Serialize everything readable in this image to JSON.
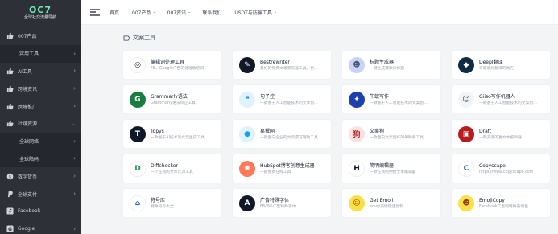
{
  "logo": {
    "mark": "OC7",
    "subtitle": "全球社交流量导航"
  },
  "sidebar": {
    "items": [
      {
        "label": "007产品",
        "icon": "thumb-up-icon",
        "arrow": ""
      },
      {
        "label": "实用工具",
        "icon": "",
        "arrow": "›",
        "sub": true
      },
      {
        "label": "AI工具",
        "icon": "thumb-up-icon",
        "arrow": "›"
      },
      {
        "label": "跨境资讯",
        "icon": "thumb-up-icon",
        "arrow": "›"
      },
      {
        "label": "跨境推广",
        "icon": "thumb-up-icon",
        "arrow": "›"
      },
      {
        "label": "社媒资源",
        "icon": "thumb-up-icon",
        "arrow": "⌄"
      },
      {
        "label": "全球网络",
        "icon": "",
        "arrow": "›",
        "sub": true
      },
      {
        "label": "全球陆码",
        "icon": "",
        "arrow": "›",
        "sub": true
      },
      {
        "label": "数字货币",
        "icon": "dollar-icon",
        "arrow": "›"
      },
      {
        "label": "全球支付",
        "icon": "paypal-icon",
        "arrow": "›"
      },
      {
        "label": "Facebook",
        "icon": "facebook-icon",
        "arrow": ""
      },
      {
        "label": "Google",
        "icon": "google-icon",
        "arrow": "›"
      }
    ]
  },
  "topbar": {
    "links": [
      {
        "label": "首页",
        "caret": ""
      },
      {
        "label": "007产品",
        "caret": "⌄"
      },
      {
        "label": "007资讯",
        "caret": "⌄"
      },
      {
        "label": "联系我们",
        "caret": ""
      },
      {
        "label": "USDT与防骗工具",
        "caret": "⌄"
      }
    ]
  },
  "section": {
    "title": "文案工具"
  },
  "cards": [
    {
      "title": "编辑词处理工具",
      "desc": "FB、Google广告的处理敏感词",
      "icon": "target-icon",
      "color": "#ffffff",
      "fg": "#111827",
      "glyph": "◎"
    },
    {
      "title": "Bestrewriter",
      "desc": "最好的免费文章重写器工具。仿…",
      "icon": "pen-icon",
      "color": "#111827",
      "fg": "#ffffff",
      "glyph": "✎"
    },
    {
      "title": "标题生成器",
      "desc": "一键生成爆款诗标题",
      "icon": "owl-icon",
      "color": "#c7d2fe",
      "fg": "#4b5563",
      "glyph": "☻"
    },
    {
      "title": "Deepl翻译",
      "desc": "可靠最好翻译的地方",
      "icon": "deepl-icon",
      "color": "#0f2b46",
      "fg": "#ffffff",
      "glyph": "◆"
    },
    {
      "title": "Grammarly语法",
      "desc": "Grammarly语法纠正工具",
      "icon": "grammarly-icon",
      "color": "#15803d",
      "fg": "#ffffff",
      "glyph": "G"
    },
    {
      "title": "句子控",
      "desc": "一款基于人工智能技术的文本创…",
      "icon": "quote-icon",
      "color": "#e0f2fe",
      "fg": "#0284c7",
      "glyph": "❝"
    },
    {
      "title": "牛蚁写作",
      "desc": "一款基于人工智能技术的文案创…",
      "icon": "ant-icon",
      "color": "#1e40af",
      "fg": "#ffffff",
      "glyph": "✦"
    },
    {
      "title": "Giiso写作机器人",
      "desc": "一款基于人工智能技术的文案创…",
      "icon": "robot-icon",
      "color": "#f3f4f6",
      "fg": "#374151",
      "glyph": "☺"
    },
    {
      "title": "Topys",
      "desc": "一款基于AI技术的文案生成工具",
      "icon": "topys-icon",
      "color": "#111827",
      "fg": "#ffffff",
      "glyph": "T"
    },
    {
      "title": "易撰网",
      "desc": "一款面向企业的文案撰写辅助工具",
      "icon": "location-icon",
      "color": "#e0f2fe",
      "fg": "#0ea5e9",
      "glyph": "●"
    },
    {
      "title": "文案狗",
      "desc": "一款面向文案创作的AI助手工具",
      "icon": "dog-icon",
      "color": "#fee2e2",
      "fg": "#b91c1c",
      "glyph": "狗"
    },
    {
      "title": "Draft",
      "desc": "一款开源的富文本编辑器",
      "icon": "draft-icon",
      "color": "#b91c1c",
      "fg": "#ffffff",
      "glyph": "▣"
    },
    {
      "title": "Diffchecker",
      "desc": "一个在线的文本比对工具",
      "icon": "diff-icon",
      "color": "#ffffff",
      "fg": "#16a34a",
      "glyph": "D"
    },
    {
      "title": "HubSpot博客创意生成器",
      "desc": "一款免费在线工具",
      "icon": "hubspot-icon",
      "color": "#ff7a59",
      "fg": "#ffffff",
      "glyph": "✺"
    },
    {
      "title": "简明编辑器",
      "desc": "一款在线的便捷文本编辑器",
      "icon": "editor-icon",
      "color": "#ffffff",
      "fg": "#111827",
      "glyph": "H"
    },
    {
      "title": "Copyscape",
      "desc": "https://www.copyscape.com",
      "icon": "copyscape-icon",
      "color": "#ffffff",
      "fg": "#1e3a8a",
      "glyph": "C"
    },
    {
      "title": "符号库",
      "desc": "特殊符号大全",
      "icon": "home-icon",
      "color": "#ffffff",
      "fg": "#2563eb",
      "glyph": "⌂"
    },
    {
      "title": "广告特殊字体",
      "desc": "FB/INS广告特殊字体",
      "icon": "font-icon",
      "color": "#111827",
      "fg": "#ffffff",
      "glyph": "A"
    },
    {
      "title": "Get Emoji",
      "desc": "emoji表情快速复制",
      "icon": "emoji-icon",
      "color": "#fde047",
      "fg": "#92400e",
      "glyph": "☺"
    },
    {
      "title": "EmojiCopy",
      "desc": "Facebook广告的特殊表情包",
      "icon": "emoji-laugh-icon",
      "color": "#fde047",
      "fg": "#92400e",
      "glyph": "☻"
    }
  ]
}
